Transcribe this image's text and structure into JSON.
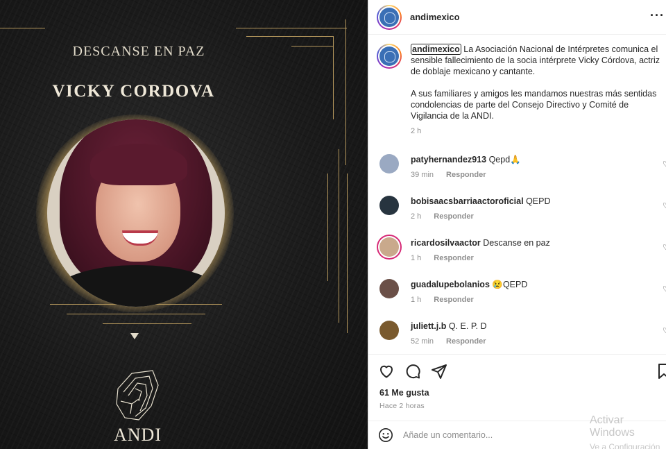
{
  "image": {
    "kicker": "DESCANSE EN PAZ",
    "name": "VICKY CORDOVA",
    "logo_text": "ANDI"
  },
  "header": {
    "username": "andimexico",
    "more_icon": "more-horizontal-icon"
  },
  "caption": {
    "username": "andimexico",
    "paragraph1": "La Asociación Nacional de Intérpretes comunica el sensible fallecimiento de la socia intérprete Vicky Córdova, actriz de doblaje mexicano y cantante.",
    "paragraph2": "A sus familiares y amigos les mandamos nuestras más sentidas condolencias de parte del Consejo Directivo y Comité de Vigilancia de la ANDI.",
    "time": "2 h"
  },
  "comments": [
    {
      "user": "patyhernandez913",
      "text": "Qepd🙏",
      "time": "39 min",
      "reply": "Responder",
      "avatar_color": "#9aa9c2",
      "ring": false
    },
    {
      "user": "bobisaacsbarriaactoroficial",
      "text": "QEPD",
      "time": "2 h",
      "reply": "Responder",
      "avatar_color": "#27343f",
      "ring": false
    },
    {
      "user": "ricardosilvaactor",
      "text": "Descanse en paz",
      "time": "1 h",
      "reply": "Responder",
      "avatar_color": "#c9a98c",
      "ring": true
    },
    {
      "user": "guadalupebolanios",
      "text": "😢QEPD",
      "time": "1 h",
      "reply": "Responder",
      "avatar_color": "#6b5048",
      "ring": false
    },
    {
      "user": "juliett.j.b",
      "text": "Q. E. P. D",
      "time": "52 min",
      "reply": "Responder",
      "avatar_color": "#7a5a2e",
      "ring": false
    }
  ],
  "actions": {
    "likes": "61 Me gusta",
    "time_ago": "Hace 2 horas"
  },
  "add_comment": {
    "placeholder": "Añade un comentario..."
  },
  "watermark": {
    "title": "Activar Windows",
    "subtitle": "Ve a Configuración para activar Windows."
  }
}
